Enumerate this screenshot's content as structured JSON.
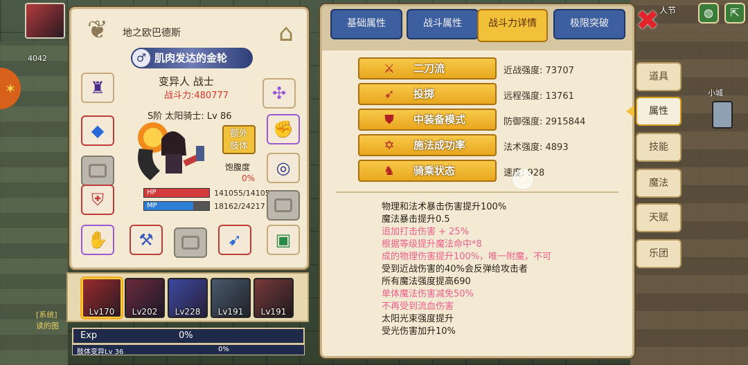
{
  "hud": {
    "player_badge": "4042",
    "event_label": "人节",
    "system_log": "[系统]\n读的图"
  },
  "character": {
    "name": "地之欧巴德斯",
    "title": "肌肉发达的金轮",
    "race_class": "变异人 战士",
    "combat_power": "战斗力:480777",
    "rank_line": "S阶 太阳骑士: Lv 86",
    "extra_limb": "额外\n肢体",
    "satiety_label": "饱腹度",
    "satiety_value": "0%",
    "hp_label": "HP",
    "hp_text": "141055/141055",
    "hp_fraction": 1.0,
    "mp_label": "MP",
    "mp_text": "18162/24217",
    "mp_fraction": 0.75
  },
  "party": [
    {
      "level": "Lv170",
      "selected": true
    },
    {
      "level": "Lv202",
      "selected": false
    },
    {
      "level": "Lv228",
      "selected": false
    },
    {
      "level": "Lv191",
      "selected": false
    },
    {
      "level": "Lv191",
      "selected": false
    }
  ],
  "exp": {
    "label": "Exp",
    "value": "0%",
    "sub_label": "肢体变异Lv 36",
    "sub_value": "0%"
  },
  "tabs": [
    {
      "label": "基础属性",
      "active": false
    },
    {
      "label": "战斗属性",
      "active": false
    },
    {
      "label": "战斗力详情",
      "active": true
    },
    {
      "label": "极限突破",
      "active": false
    }
  ],
  "stats": [
    {
      "label": "二刀流",
      "icon": "sword-icon",
      "value": "近战强度: 73707"
    },
    {
      "label": "投掷",
      "icon": "bow-icon",
      "value": "远程强度: 13761"
    },
    {
      "label": "中装备模式",
      "icon": "shield-icon",
      "value": "防御强度: 2915844"
    },
    {
      "label": "施法成功率",
      "icon": "hexagram-icon",
      "value": "法术强度: 4893"
    },
    {
      "label": "骑乘状态",
      "icon": "horse-icon",
      "value": "速度: 928"
    }
  ],
  "effects": [
    {
      "text": "物理和法术暴击伤害提升100%",
      "color": "black"
    },
    {
      "text": "魔法暴击提升0.5",
      "color": "black"
    },
    {
      "text": "追加打击伤害 + 25%",
      "color": "pink"
    },
    {
      "text": "根据等级提升魔法命中*8",
      "color": "pink"
    },
    {
      "text": "成的物理伤害提升100%，唯一附魔，不可",
      "color": "pink"
    },
    {
      "text": "受到近战伤害的40%会反弹给攻击者",
      "color": "black"
    },
    {
      "text": "所有魔法强度提高690",
      "color": "black"
    },
    {
      "text": "单体魔法伤害减免50%",
      "color": "pink"
    },
    {
      "text": "不再受到流血伤害",
      "color": "pink"
    },
    {
      "text": "太阳光束强度提升",
      "color": "black"
    },
    {
      "text": "受光伤害加升10%",
      "color": "black"
    }
  ],
  "side_menu": [
    {
      "label": "道具",
      "active": false
    },
    {
      "label": "属性",
      "active": true
    },
    {
      "label": "技能",
      "active": false
    },
    {
      "label": "魔法",
      "active": false
    },
    {
      "label": "天赋",
      "active": false
    },
    {
      "label": "乐团",
      "active": false
    }
  ],
  "map_label": "小城",
  "colors": {
    "panel_bg": "#f4ead3",
    "tab_blue": "#3d5fa0",
    "tab_active": "#f2c13a",
    "highlight_pink": "#ef5f8a",
    "combat_red": "#d8342a"
  }
}
